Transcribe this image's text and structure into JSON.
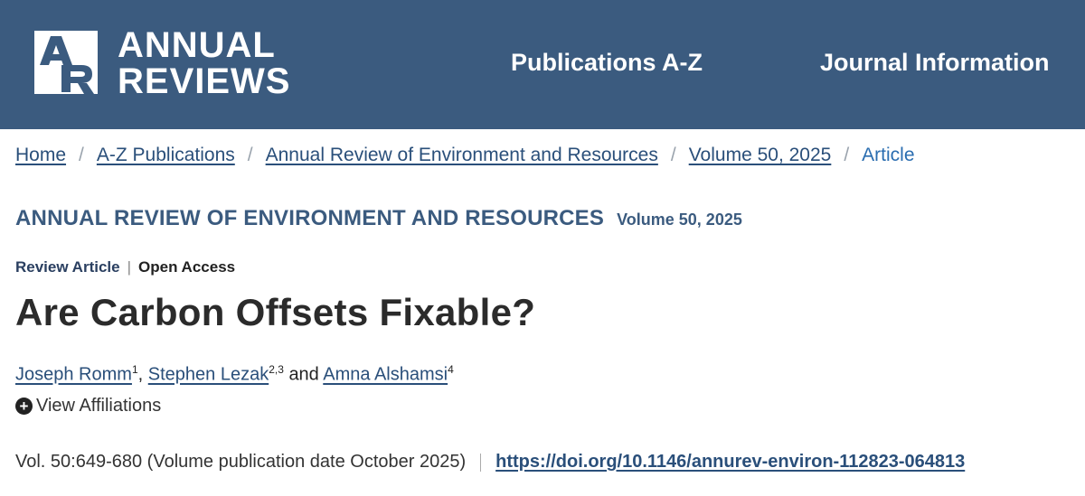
{
  "header": {
    "logo_mark": "AR",
    "logo_line1": "ANNUAL",
    "logo_line2": "REVIEWS",
    "nav": {
      "publications": "Publications A-Z",
      "journal_info": "Journal Information"
    },
    "background_color": "#3b5b7f"
  },
  "breadcrumb": {
    "items": [
      {
        "label": "Home"
      },
      {
        "label": "A-Z Publications"
      },
      {
        "label": "Annual Review of Environment and Resources"
      },
      {
        "label": "Volume 50, 2025"
      },
      {
        "label": "Article"
      }
    ],
    "separator": "/"
  },
  "journal": {
    "title": "ANNUAL REVIEW OF ENVIRONMENT AND RESOURCES",
    "volume": "Volume 50, 2025"
  },
  "article": {
    "type": "Review Article",
    "access": "Open Access",
    "title": "Are Carbon Offsets Fixable?",
    "authors": [
      {
        "name": "Joseph Romm",
        "sup": "1"
      },
      {
        "name": "Stephen Lezak",
        "sup": "2,3"
      },
      {
        "name": "Amna Alshamsi",
        "sup": "4"
      }
    ],
    "author_joiner_comma": ",",
    "author_joiner_and": "and",
    "affiliations_label": "View Affiliations",
    "citation": "Vol. 50:649-680 (Volume publication date October 2025)",
    "doi": "https://doi.org/10.1146/annurev-environ-112823-064813"
  }
}
